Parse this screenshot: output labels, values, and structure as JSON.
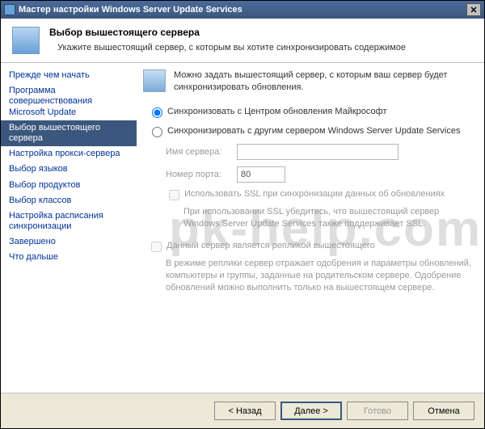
{
  "window": {
    "title": "Мастер настройки Windows Server Update Services"
  },
  "header": {
    "title": "Выбор вышестоящего сервера",
    "subtitle": "Укажите вышестоящий сервер, с которым вы хотите синхронизировать содержимое"
  },
  "sidebar": {
    "items": [
      "Прежде чем начать",
      "Программа совершенствования Microsoft Update",
      "Выбор вышестоящего сервера",
      "Настройка прокси-сервера",
      "Выбор языков",
      "Выбор продуктов",
      "Выбор классов",
      "Настройка расписания синхронизации",
      "Завершено",
      "Что дальше"
    ],
    "selected_index": 2
  },
  "main": {
    "intro": "Можно задать вышестоящий сервер, с которым ваш сервер будет синхронизировать обновления.",
    "radio1": "Синхронизовать с Центром обновления Майкрософт",
    "radio2": "Синхронизировать с другим сервером Windows Server Update Services",
    "server_name_label": "Имя сервера:",
    "server_name_value": "",
    "port_label": "Номер порта:",
    "port_value": "80",
    "ssl_label": "Использовать SSL при синхронизации данных об обновлениях",
    "ssl_note": "При использовании SSL убедитесь, что вышестоящий сервер Windows Server Update Services также поддерживает SSL.",
    "replica_label": "Данный сервер является репликой вышестоящего",
    "replica_note": "В режиме реплики сервер отражает одобрения и параметры обновлений, компьютеры и группы, заданные на родительском сервере. Одобрение обновлений можно выполнить только на вышестоящем сервере."
  },
  "footer": {
    "back": "< Назад",
    "next": "Далее >",
    "finish": "Готово",
    "cancel": "Отмена"
  },
  "watermark": "pk-help.com"
}
